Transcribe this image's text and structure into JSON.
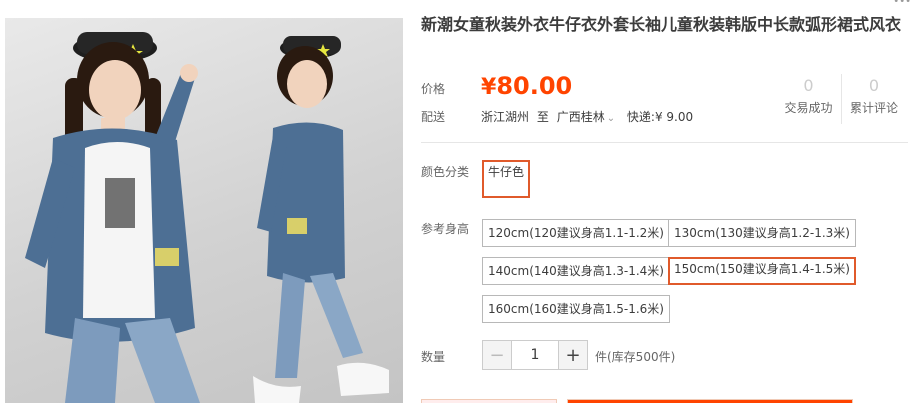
{
  "product": {
    "title": "新潮女童秋装外衣牛仔衣外套长袖儿童秋装韩版中长款弧形裙式风衣"
  },
  "price": {
    "label": "价格",
    "currency": "¥",
    "value": "80.00"
  },
  "stats": {
    "sold_count": "0",
    "sold_label": "交易成功",
    "review_count": "0",
    "review_label": "累计评论"
  },
  "shipping": {
    "label": "配送",
    "from": "浙江湖州",
    "to_prefix": "至",
    "to": "广西桂林",
    "fee": "快递:¥ 9.00"
  },
  "color": {
    "label": "颜色分类",
    "options": [
      "牛仔色"
    ]
  },
  "size": {
    "label": "参考身高",
    "options": [
      "120cm(120建议身高1.1-1.2米)",
      "130cm(130建议身高1.2-1.3米)",
      "140cm(140建议身高1.3-1.4米)",
      "150cm(150建议身高1.4-1.5米)",
      "160cm(160建议身高1.5-1.6米)"
    ]
  },
  "quantity": {
    "label": "数量",
    "value": "1",
    "stock": "件(库存500件)"
  },
  "colors": {
    "accent": "#ff4400",
    "selected_border": "#e05a2b"
  }
}
